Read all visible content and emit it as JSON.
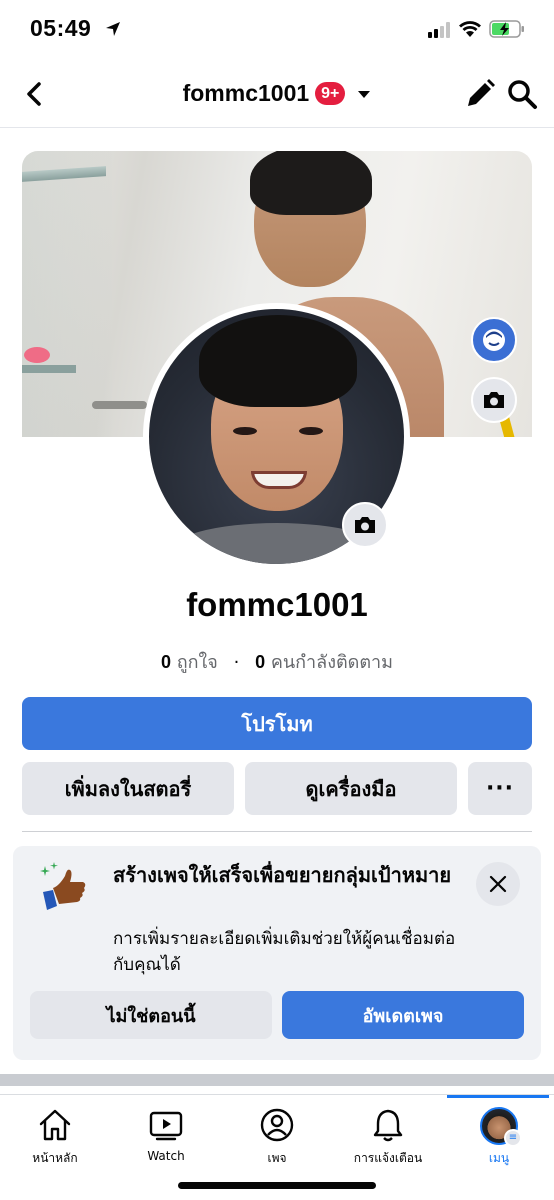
{
  "status_bar": {
    "time": "05:49"
  },
  "nav": {
    "title": "fommc1001",
    "badge": "9+"
  },
  "profile": {
    "name": "fommc1001",
    "likes_count": "0",
    "likes_label": "ถูกใจ",
    "followers_count": "0",
    "followers_label": "คนกำลังติดตาม"
  },
  "actions": {
    "promote": "โปรโมท",
    "add_to_story": "เพิ่มลงในสตอรี่",
    "view_tools": "ดูเครื่องมือ",
    "more": "···"
  },
  "card": {
    "title": "สร้างเพจให้เสร็จเพื่อขยายกลุ่มเป้าหมาย",
    "description": "การเพิ่มรายละเอียดเพิ่มเติมช่วยให้ผู้คนเชื่อมต่อกับคุณได้",
    "not_now": "ไม่ใช่ตอนนี้",
    "update_page": "อัพเดตเพจ"
  },
  "tabs": [
    {
      "label": "หน้าหลัก",
      "icon": "home-icon"
    },
    {
      "label": "Watch",
      "icon": "watch-icon"
    },
    {
      "label": "เพจ",
      "icon": "page-icon"
    },
    {
      "label": "การแจ้งเตือน",
      "icon": "bell-icon"
    },
    {
      "label": "เมนู",
      "icon": "menu-avatar"
    }
  ],
  "colors": {
    "primary": "#3a78dd",
    "badge": "#e41e3f",
    "active_tab": "#1877f2"
  }
}
